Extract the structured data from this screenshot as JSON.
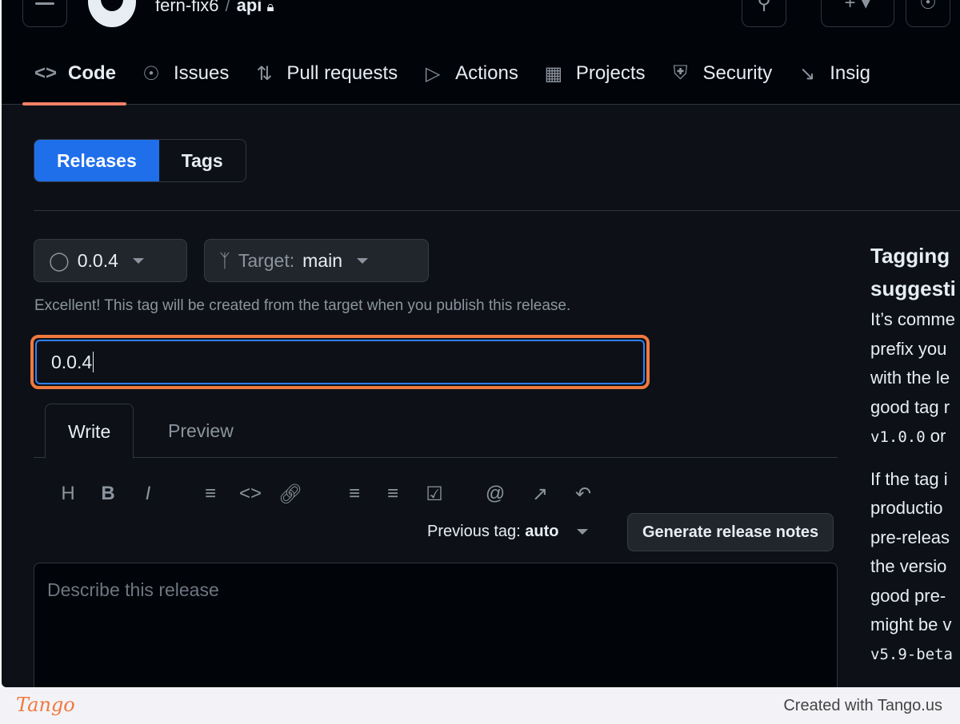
{
  "header": {
    "owner": "fern-fix6",
    "separator": "/",
    "repo": "api"
  },
  "nav": [
    {
      "icon": "code-icon",
      "label": "Code",
      "active": true
    },
    {
      "icon": "issue-icon",
      "label": "Issues"
    },
    {
      "icon": "pull-request-icon",
      "label": "Pull requests"
    },
    {
      "icon": "play-icon",
      "label": "Actions"
    },
    {
      "icon": "table-icon",
      "label": "Projects"
    },
    {
      "icon": "shield-icon",
      "label": "Security"
    },
    {
      "icon": "graph-icon",
      "label": "Insig"
    }
  ],
  "segment": {
    "releases": "Releases",
    "tags": "Tags"
  },
  "tag_button": "0.0.4",
  "target": {
    "label": "Target:",
    "value": "main"
  },
  "note": "Excellent! This tag will be created from the target when you publish this release.",
  "title_input": {
    "value": "0.0.4"
  },
  "editor": {
    "tabs": [
      "Write",
      "Preview"
    ],
    "previous_tag_label": "Previous tag:",
    "previous_tag_value": "auto",
    "generate": "Generate release notes",
    "placeholder": "Describe this release"
  },
  "sidebar": {
    "heading": [
      "Tagging",
      "suggesti"
    ],
    "para1": [
      "It’s comme",
      "prefix you",
      "with the le",
      "good tag r"
    ],
    "para1_mono": "v1.0.0",
    "para1_end": " or",
    "para2": [
      "If the tag i",
      "productio",
      "pre-releas",
      "the versio",
      "good pre-",
      "might be v"
    ],
    "para2_mono": "v5.9-beta"
  },
  "footer": {
    "brand": "Tango",
    "credit": "Created with Tango.us"
  },
  "colors": {
    "accent": "#1f6feb",
    "highlight": "#f0793e",
    "bg": "#0d1117"
  }
}
